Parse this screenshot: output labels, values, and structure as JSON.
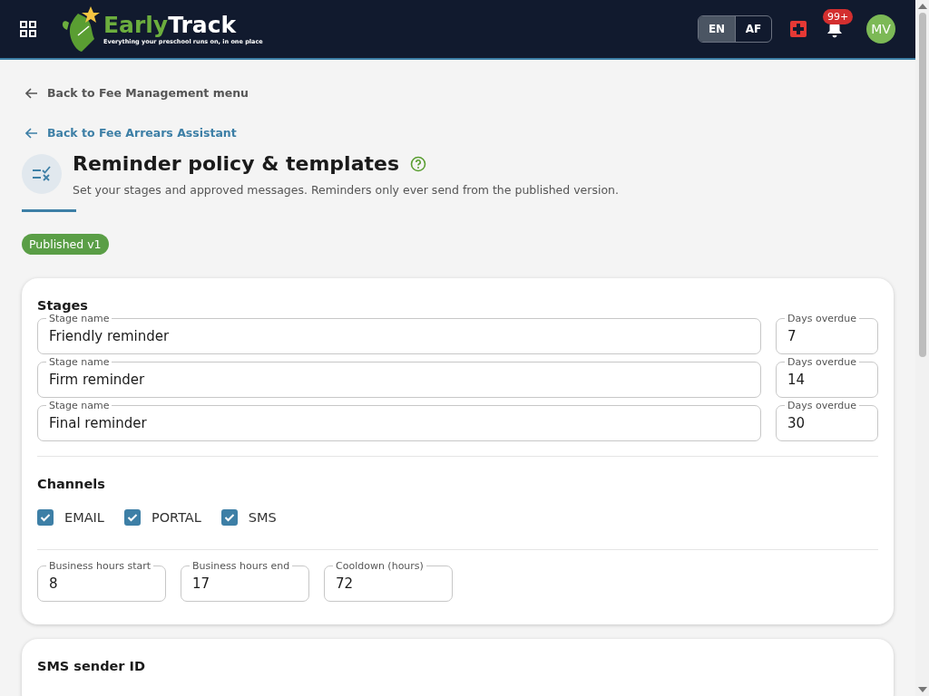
{
  "header": {
    "brand_part_1": "Early",
    "brand_part_2": "Track",
    "tagline": "Everything your preschool runs on, in one place",
    "languages": [
      {
        "label": "EN",
        "selected": true
      },
      {
        "label": "AF",
        "selected": false
      }
    ],
    "notification_count": "99+",
    "avatar_initials": "MV"
  },
  "back_links": [
    {
      "label": "Back to Fee Management menu",
      "kind": "muted"
    },
    {
      "label": "Back to Fee Arrears Assistant",
      "kind": "accent"
    }
  ],
  "page": {
    "title": "Reminder policy & templates",
    "subtitle": "Set your stages and approved messages. Reminders only ever send from the published version.",
    "status_badge": "Published v1"
  },
  "stages": {
    "title": "Stages",
    "rows": [
      {
        "name_label": "Stage name",
        "name": "Friendly reminder",
        "days_label": "Days overdue",
        "days": "7"
      },
      {
        "name_label": "Stage name",
        "name": "Firm reminder",
        "days_label": "Days overdue",
        "days": "14"
      },
      {
        "name_label": "Stage name",
        "name": "Final reminder",
        "days_label": "Days overdue",
        "days": "30"
      }
    ]
  },
  "channels": {
    "title": "Channels",
    "items": [
      {
        "label": "EMAIL",
        "checked": true
      },
      {
        "label": "PORTAL",
        "checked": true
      },
      {
        "label": "SMS",
        "checked": true
      }
    ]
  },
  "hours": [
    {
      "label": "Business hours start",
      "value": "8"
    },
    {
      "label": "Business hours end",
      "value": "17"
    },
    {
      "label": "Cooldown (hours)",
      "value": "72"
    }
  ],
  "sms_sender": {
    "title": "SMS sender ID"
  }
}
